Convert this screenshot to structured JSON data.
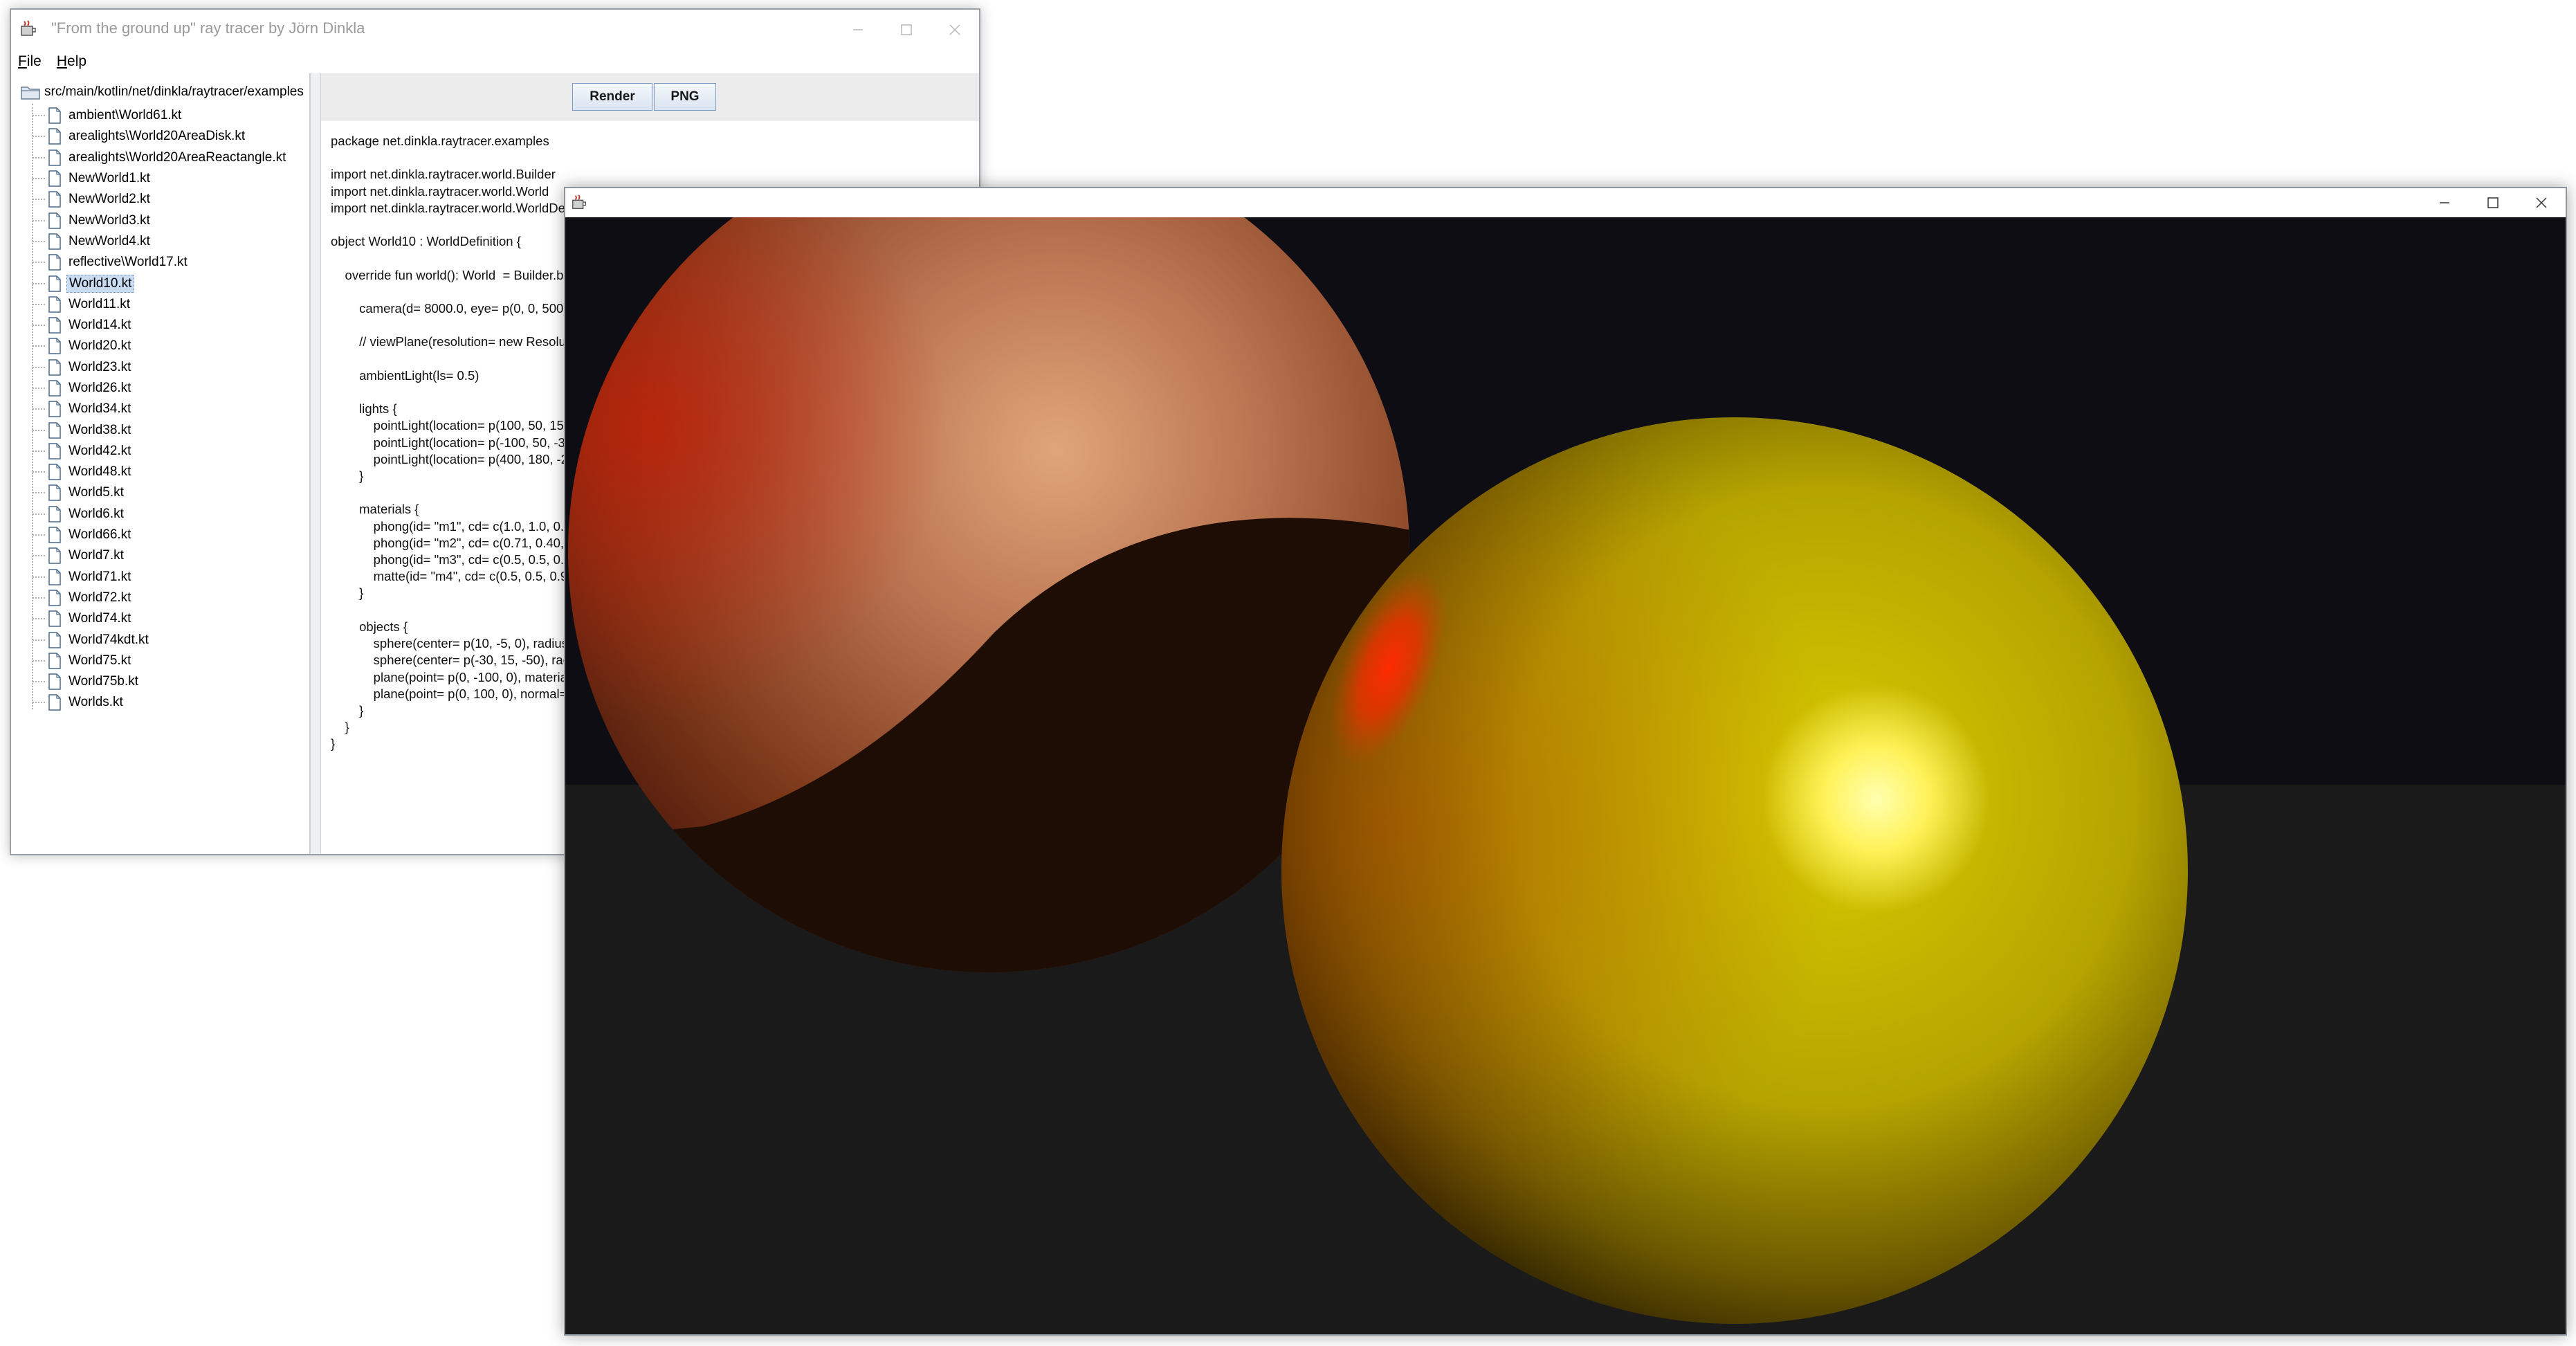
{
  "main_window": {
    "title": "\"From the ground up\" ray tracer by Jörn Dinkla",
    "menu": [
      {
        "mnemonic": "F",
        "rest": "ile"
      },
      {
        "mnemonic": "H",
        "rest": "elp"
      }
    ]
  },
  "tree": {
    "root": "src/main/kotlin/net/dinkla/raytracer/examples",
    "items": [
      "ambient\\World61.kt",
      "arealights\\World20AreaDisk.kt",
      "arealights\\World20AreaReactangle.kt",
      "NewWorld1.kt",
      "NewWorld2.kt",
      "NewWorld3.kt",
      "NewWorld4.kt",
      "reflective\\World17.kt",
      "World10.kt",
      "World11.kt",
      "World14.kt",
      "World20.kt",
      "World23.kt",
      "World26.kt",
      "World34.kt",
      "World38.kt",
      "World42.kt",
      "World48.kt",
      "World5.kt",
      "World6.kt",
      "World66.kt",
      "World7.kt",
      "World71.kt",
      "World72.kt",
      "World74.kt",
      "World74kdt.kt",
      "World75.kt",
      "World75b.kt",
      "Worlds.kt"
    ],
    "selected_item": "World10.kt"
  },
  "toolbar": {
    "render_label": "Render",
    "png_label": "PNG"
  },
  "code": "package net.dinkla.raytracer.examples\n\nimport net.dinkla.raytracer.world.Builder\nimport net.dinkla.raytracer.world.World\nimport net.dinkla.raytracer.world.WorldDefi\n\nobject World10 : WorldDefinition {\n\n    override fun world(): World  = Builder.bui\n\n        camera(d= 8000.0, eye= p(0, 0, 500),\n\n        // viewPlane(resolution= new Resoluti\n\n        ambientLight(ls= 0.5)\n\n        lights {\n            pointLight(location= p(100, 50, 150)\n            pointLight(location= p(-100, 50, -30)\n            pointLight(location= p(400, 180, -20\n        }\n\n        materials {\n            phong(id= \"m1\", cd= c(1.0, 1.0, 0.0)\n            phong(id= \"m2\", cd= c(0.71, 0.40, 0\n            phong(id= \"m3\", cd= c(0.5, 0.5, 0.5)\n            matte(id= \"m4\", cd= c(0.5, 0.5, 0.99\n        }\n\n        objects {\n            sphere(center= p(10, -5, 0), radius=\n            sphere(center= p(-30, 15, -50), radi\n            plane(point= p(0, -100, 0), material=\n            plane(point= p(0, 100, 0), normal= n\n        }\n    }\n}",
  "colors": {
    "background_far": "#0e0d14",
    "floor": "#1b1a1a",
    "sphere_front": "#d4c400",
    "sphere_back": "#c98a60",
    "highlight_red": "#ff2a00",
    "selection": "#c9dcf2"
  },
  "icons": {
    "app": "java-coffee-icon",
    "folder": "folder-icon",
    "file": "file-icon",
    "minimize": "minimize-icon",
    "maximize": "maximize-icon",
    "close": "close-icon"
  }
}
